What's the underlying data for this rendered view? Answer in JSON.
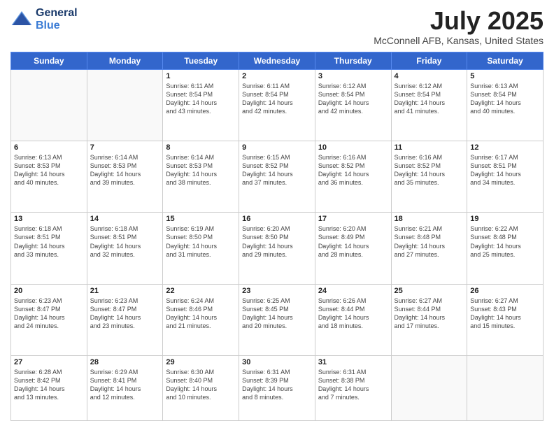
{
  "header": {
    "logo_line1": "General",
    "logo_line2": "Blue",
    "month": "July 2025",
    "location": "McConnell AFB, Kansas, United States"
  },
  "days_of_week": [
    "Sunday",
    "Monday",
    "Tuesday",
    "Wednesday",
    "Thursday",
    "Friday",
    "Saturday"
  ],
  "weeks": [
    [
      {
        "day": "",
        "info": ""
      },
      {
        "day": "",
        "info": ""
      },
      {
        "day": "1",
        "info": "Sunrise: 6:11 AM\nSunset: 8:54 PM\nDaylight: 14 hours\nand 43 minutes."
      },
      {
        "day": "2",
        "info": "Sunrise: 6:11 AM\nSunset: 8:54 PM\nDaylight: 14 hours\nand 42 minutes."
      },
      {
        "day": "3",
        "info": "Sunrise: 6:12 AM\nSunset: 8:54 PM\nDaylight: 14 hours\nand 42 minutes."
      },
      {
        "day": "4",
        "info": "Sunrise: 6:12 AM\nSunset: 8:54 PM\nDaylight: 14 hours\nand 41 minutes."
      },
      {
        "day": "5",
        "info": "Sunrise: 6:13 AM\nSunset: 8:54 PM\nDaylight: 14 hours\nand 40 minutes."
      }
    ],
    [
      {
        "day": "6",
        "info": "Sunrise: 6:13 AM\nSunset: 8:53 PM\nDaylight: 14 hours\nand 40 minutes."
      },
      {
        "day": "7",
        "info": "Sunrise: 6:14 AM\nSunset: 8:53 PM\nDaylight: 14 hours\nand 39 minutes."
      },
      {
        "day": "8",
        "info": "Sunrise: 6:14 AM\nSunset: 8:53 PM\nDaylight: 14 hours\nand 38 minutes."
      },
      {
        "day": "9",
        "info": "Sunrise: 6:15 AM\nSunset: 8:52 PM\nDaylight: 14 hours\nand 37 minutes."
      },
      {
        "day": "10",
        "info": "Sunrise: 6:16 AM\nSunset: 8:52 PM\nDaylight: 14 hours\nand 36 minutes."
      },
      {
        "day": "11",
        "info": "Sunrise: 6:16 AM\nSunset: 8:52 PM\nDaylight: 14 hours\nand 35 minutes."
      },
      {
        "day": "12",
        "info": "Sunrise: 6:17 AM\nSunset: 8:51 PM\nDaylight: 14 hours\nand 34 minutes."
      }
    ],
    [
      {
        "day": "13",
        "info": "Sunrise: 6:18 AM\nSunset: 8:51 PM\nDaylight: 14 hours\nand 33 minutes."
      },
      {
        "day": "14",
        "info": "Sunrise: 6:18 AM\nSunset: 8:51 PM\nDaylight: 14 hours\nand 32 minutes."
      },
      {
        "day": "15",
        "info": "Sunrise: 6:19 AM\nSunset: 8:50 PM\nDaylight: 14 hours\nand 31 minutes."
      },
      {
        "day": "16",
        "info": "Sunrise: 6:20 AM\nSunset: 8:50 PM\nDaylight: 14 hours\nand 29 minutes."
      },
      {
        "day": "17",
        "info": "Sunrise: 6:20 AM\nSunset: 8:49 PM\nDaylight: 14 hours\nand 28 minutes."
      },
      {
        "day": "18",
        "info": "Sunrise: 6:21 AM\nSunset: 8:48 PM\nDaylight: 14 hours\nand 27 minutes."
      },
      {
        "day": "19",
        "info": "Sunrise: 6:22 AM\nSunset: 8:48 PM\nDaylight: 14 hours\nand 25 minutes."
      }
    ],
    [
      {
        "day": "20",
        "info": "Sunrise: 6:23 AM\nSunset: 8:47 PM\nDaylight: 14 hours\nand 24 minutes."
      },
      {
        "day": "21",
        "info": "Sunrise: 6:23 AM\nSunset: 8:47 PM\nDaylight: 14 hours\nand 23 minutes."
      },
      {
        "day": "22",
        "info": "Sunrise: 6:24 AM\nSunset: 8:46 PM\nDaylight: 14 hours\nand 21 minutes."
      },
      {
        "day": "23",
        "info": "Sunrise: 6:25 AM\nSunset: 8:45 PM\nDaylight: 14 hours\nand 20 minutes."
      },
      {
        "day": "24",
        "info": "Sunrise: 6:26 AM\nSunset: 8:44 PM\nDaylight: 14 hours\nand 18 minutes."
      },
      {
        "day": "25",
        "info": "Sunrise: 6:27 AM\nSunset: 8:44 PM\nDaylight: 14 hours\nand 17 minutes."
      },
      {
        "day": "26",
        "info": "Sunrise: 6:27 AM\nSunset: 8:43 PM\nDaylight: 14 hours\nand 15 minutes."
      }
    ],
    [
      {
        "day": "27",
        "info": "Sunrise: 6:28 AM\nSunset: 8:42 PM\nDaylight: 14 hours\nand 13 minutes."
      },
      {
        "day": "28",
        "info": "Sunrise: 6:29 AM\nSunset: 8:41 PM\nDaylight: 14 hours\nand 12 minutes."
      },
      {
        "day": "29",
        "info": "Sunrise: 6:30 AM\nSunset: 8:40 PM\nDaylight: 14 hours\nand 10 minutes."
      },
      {
        "day": "30",
        "info": "Sunrise: 6:31 AM\nSunset: 8:39 PM\nDaylight: 14 hours\nand 8 minutes."
      },
      {
        "day": "31",
        "info": "Sunrise: 6:31 AM\nSunset: 8:38 PM\nDaylight: 14 hours\nand 7 minutes."
      },
      {
        "day": "",
        "info": ""
      },
      {
        "day": "",
        "info": ""
      }
    ]
  ]
}
